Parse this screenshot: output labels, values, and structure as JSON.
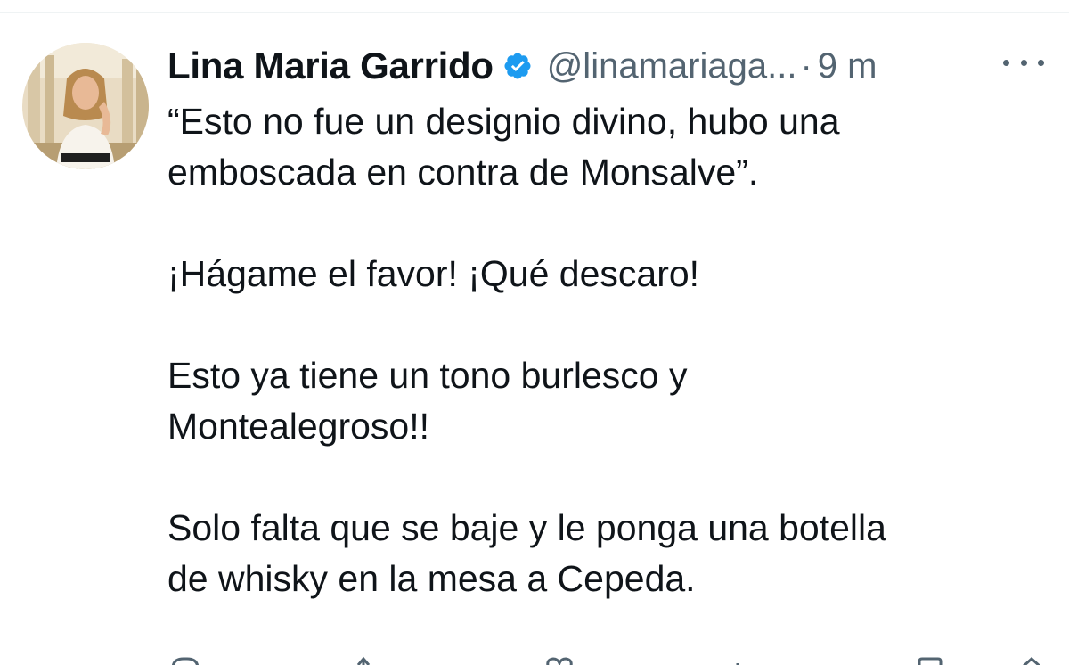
{
  "tweet": {
    "author": {
      "display_name": "Lina Maria Garrido",
      "handle": "@linamariaga...",
      "verified": true,
      "avatar_icon": "profile-photo"
    },
    "separator": "·",
    "time": "9 m",
    "more_icon": "more-horizontal-icon",
    "body": {
      "line1": "“Esto no fue un designio divino, hubo una",
      "line2": "emboscada en contra de Monsalve”.",
      "line3": "¡Hágame el favor! ¡Qué descaro!",
      "line4": "Esto ya tiene un tono burlesco y",
      "line5": "Montealegroso!!",
      "line6": "Solo falta que se baje y le ponga una botella",
      "line7": "de whisky en la mesa a Cepeda."
    },
    "actions": [
      "reply-icon",
      "retweet-icon",
      "like-icon",
      "views-icon",
      "bookmark-icon",
      "share-icon"
    ]
  },
  "colors": {
    "text": "#0f1419",
    "secondary": "#536471",
    "verified": "#1d9bf0",
    "divider": "#eff3f4"
  }
}
